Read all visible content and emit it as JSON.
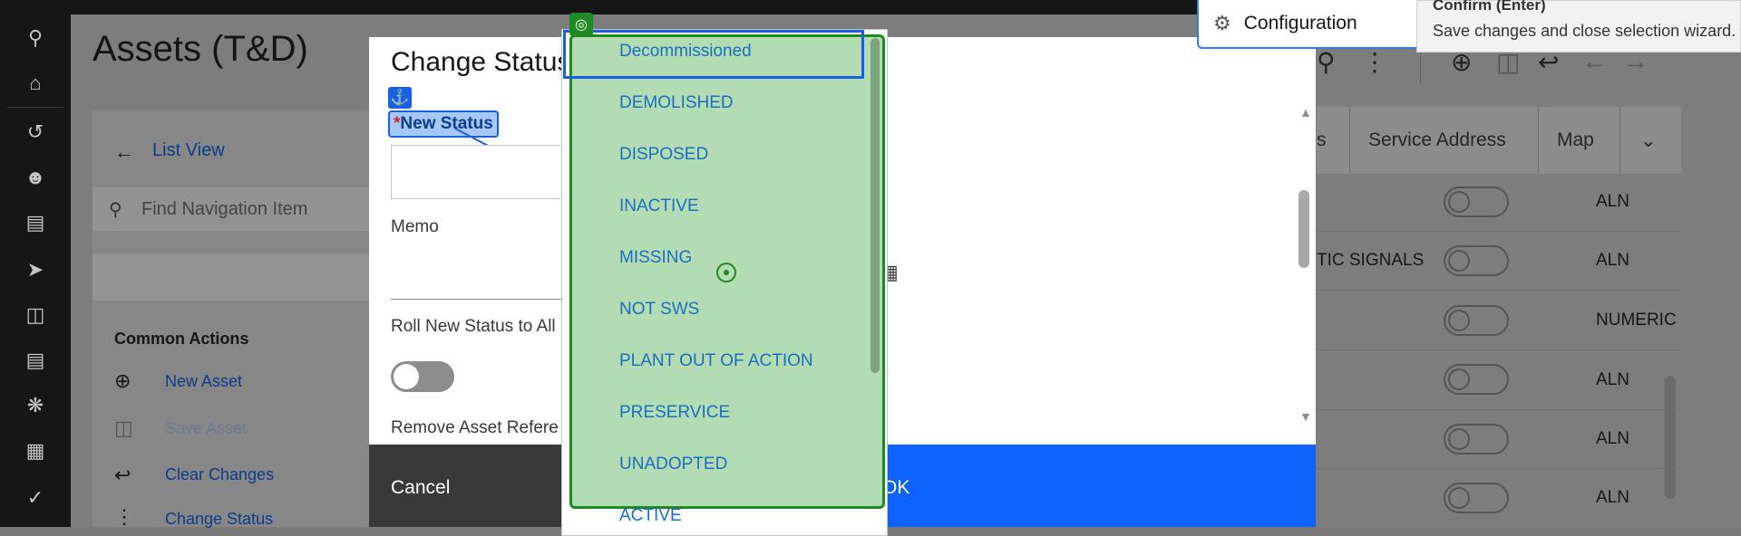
{
  "page": {
    "title": "Assets (T&D)",
    "list_view": "List View",
    "search_placeholder": "Find Navigation Item",
    "common_actions": "Common Actions",
    "actions": [
      "New Asset",
      "Save Asset",
      "Clear Changes",
      "Change Status"
    ]
  },
  "table": {
    "headers": [
      "s",
      "Service Address",
      "Map"
    ],
    "rows": [
      {
        "service": "",
        "type": "ALN"
      },
      {
        "service": "TIC SIGNALS",
        "type": "ALN"
      },
      {
        "service": "",
        "type": "NUMERIC"
      },
      {
        "service": "",
        "type": "ALN"
      },
      {
        "service": "",
        "type": "ALN"
      },
      {
        "service": "",
        "type": "ALN"
      }
    ]
  },
  "modal": {
    "title": "Change Status",
    "new_status_label": "New Status",
    "required_mark": "*",
    "memo_label": "Memo",
    "roll_label": "Roll New Status to All",
    "remove_label": "Remove Asset Refere",
    "cancel": "Cancel",
    "ok": "OK"
  },
  "dropdown": {
    "options": [
      "Decommissioned",
      "DEMOLISHED",
      "DISPOSED",
      "INACTIVE",
      "MISSING",
      "NOT SWS",
      "PLANT OUT OF ACTION",
      "PRESERVICE",
      "UNADOPTED",
      "ACTIVE"
    ],
    "highlighted": "Decommissioned"
  },
  "tooltip": {
    "config": "Configuration",
    "confirm_title": "Confirm (Enter)",
    "confirm_desc": "Save changes and close selection wizard."
  }
}
